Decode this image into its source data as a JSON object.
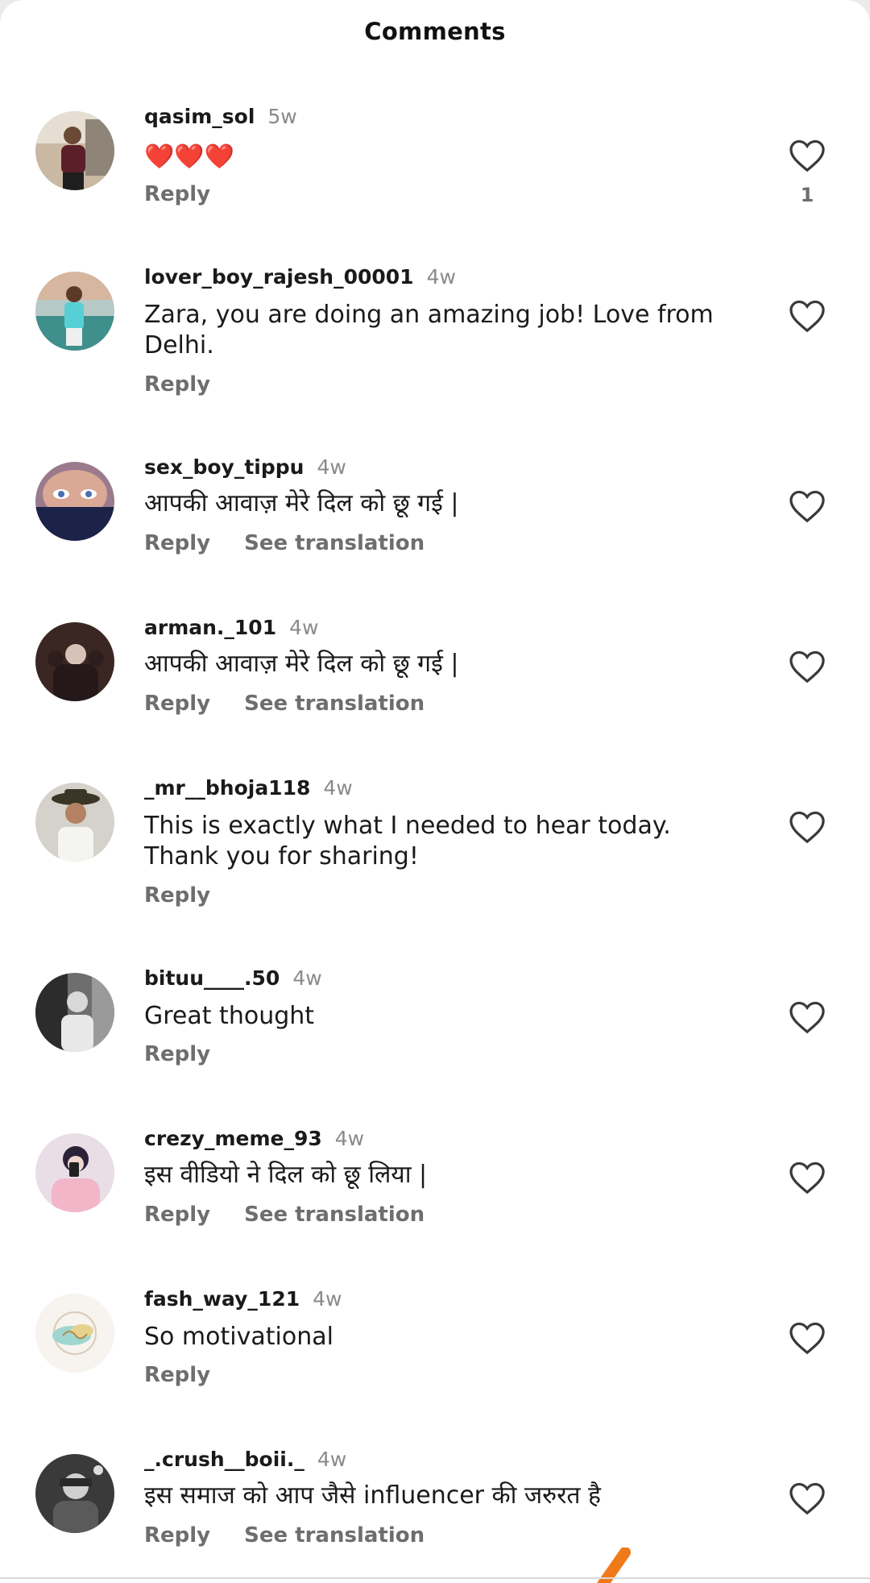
{
  "header": {
    "title": "Comments"
  },
  "colors": {
    "heart_stroke": "#3a3a3a",
    "muted_text": "#6e6e6e",
    "timestamp": "#8a8a8a",
    "scroll_accent": "#f07a1a"
  },
  "comments": [
    {
      "username": "qasim_sol",
      "time": "5w",
      "text": "❤️❤️❤️",
      "reply": "Reply",
      "likes": "1"
    },
    {
      "username": "lover_boy_rajesh_00001",
      "time": "4w",
      "text": "Zara, you are doing an amazing job! Love from Delhi.",
      "reply": "Reply"
    },
    {
      "username": "sex_boy_tippu",
      "time": "4w",
      "text": "आपकी आवाज़ मेरे दिल को छू गई |",
      "reply": "Reply",
      "translate": "See translation"
    },
    {
      "username": "arman._101",
      "time": "4w",
      "text": "आपकी आवाज़ मेरे दिल को छू गई |",
      "reply": "Reply",
      "translate": "See translation"
    },
    {
      "username": "_mr__bhoja118",
      "time": "4w",
      "text": "This is exactly what I needed to hear today. Thank you for sharing!",
      "reply": "Reply"
    },
    {
      "username": "bituu____.50",
      "time": "4w",
      "text": "Great thought",
      "reply": "Reply"
    },
    {
      "username": "crezy_meme_93",
      "time": "4w",
      "text": "इस वीडियो ने दिल को छू लिया |",
      "reply": "Reply",
      "translate": "See translation"
    },
    {
      "username": "fash_way_121",
      "time": "4w",
      "text": "So motivational",
      "reply": "Reply"
    },
    {
      "username": "_.crush__boii._",
      "time": "4w",
      "text": "इस समाज को आप जैसे influencer की जरुरत है",
      "reply": "Reply",
      "translate": "See translation"
    }
  ]
}
